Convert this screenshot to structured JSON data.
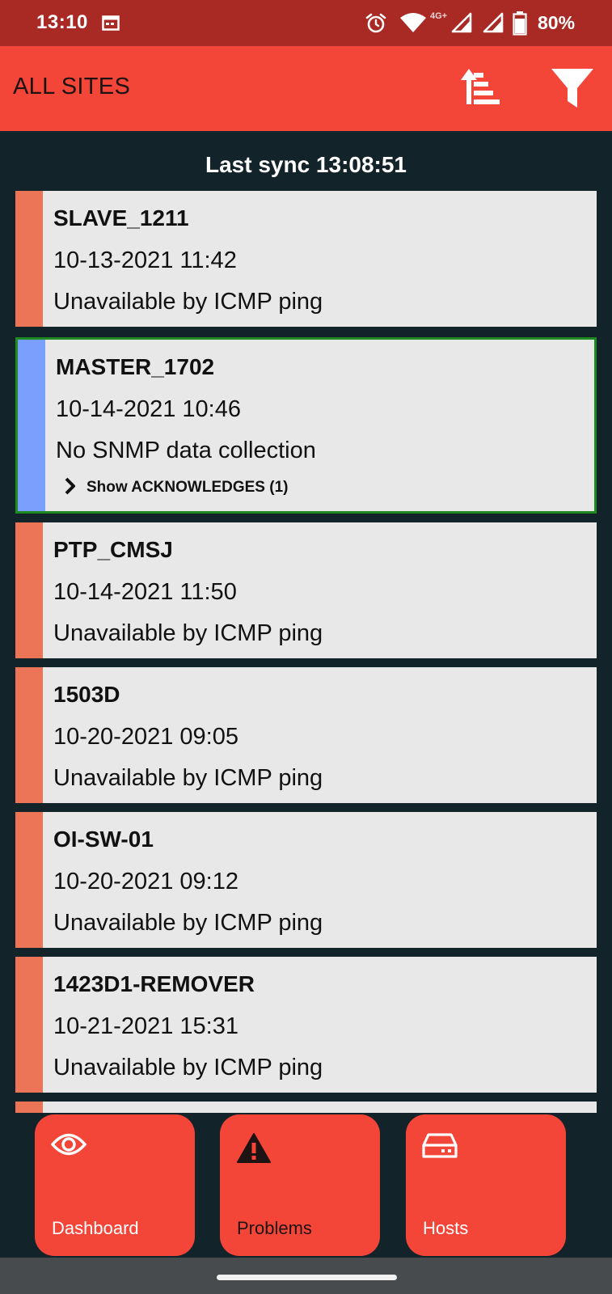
{
  "status_bar": {
    "time": "13:10",
    "network_type": "4G+",
    "battery_percent": "80%",
    "icons": [
      "calendar-icon",
      "alarm-icon",
      "wifi-icon",
      "signal-icon",
      "signal-icon",
      "battery-icon"
    ]
  },
  "app_bar": {
    "title": "ALL SITES",
    "sort_icon": "sort-icon",
    "filter_icon": "filter-icon"
  },
  "sync": {
    "label": "Last sync 13:08:51"
  },
  "colors": {
    "status_bar": "#a92a24",
    "accent": "#f44539",
    "background": "#12232a",
    "card": "#e8e8e8",
    "severity_high": "#ec7558",
    "severity_info": "#7a9ffc",
    "selected_border": "#1e8a22"
  },
  "problems": [
    {
      "host": "SLAVE_1211",
      "time": "10-13-2021 11:42",
      "description": "Unavailable by ICMP ping",
      "severity_color": "#ec7558",
      "selected": false
    },
    {
      "host": "MASTER_1702",
      "time": "10-14-2021 10:46",
      "description": "No SNMP data collection",
      "severity_color": "#7a9ffc",
      "selected": true,
      "ack_label": "Show ACKNOWLEDGES (1)"
    },
    {
      "host": "PTP_CMSJ",
      "time": "10-14-2021 11:50",
      "description": "Unavailable by ICMP ping",
      "severity_color": "#ec7558",
      "selected": false
    },
    {
      "host": "1503D",
      "time": "10-20-2021 09:05",
      "description": "Unavailable by ICMP ping",
      "severity_color": "#ec7558",
      "selected": false
    },
    {
      "host": "OI-SW-01",
      "time": "10-20-2021 09:12",
      "description": "Unavailable by ICMP ping",
      "severity_color": "#ec7558",
      "selected": false
    },
    {
      "host": "1423D1-REMOVER",
      "time": "10-21-2021 15:31",
      "description": "Unavailable by ICMP ping",
      "severity_color": "#ec7558",
      "selected": false
    }
  ],
  "bottom_nav": [
    {
      "label": "Dashboard",
      "icon": "eye-icon"
    },
    {
      "label": "Problems",
      "icon": "warning-icon"
    },
    {
      "label": "Hosts",
      "icon": "server-icon"
    }
  ]
}
